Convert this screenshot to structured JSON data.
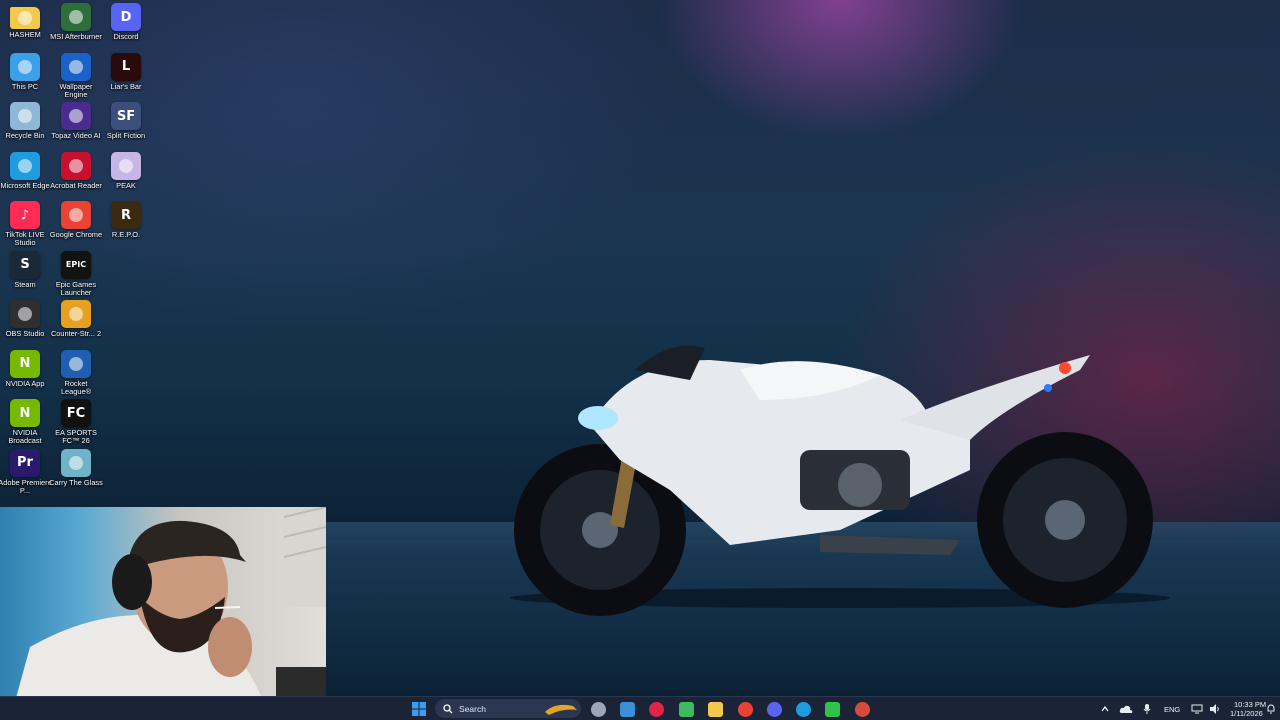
{
  "desktop": {
    "icons": [
      {
        "id": "hashem",
        "label": "HASHEM",
        "icon": "folder-icon",
        "color": "#f2c94c"
      },
      {
        "id": "this-pc",
        "label": "This PC",
        "icon": "monitor-icon",
        "color": "#3aa0e8"
      },
      {
        "id": "recycle-bin",
        "label": "Recycle Bin",
        "icon": "recycle-bin-icon",
        "color": "#8fb8d8"
      },
      {
        "id": "microsoft-edge",
        "label": "Microsoft Edge",
        "icon": "edge-icon",
        "color": "#1f9be0"
      },
      {
        "id": "tiktok-live-studio",
        "label": "TikTok LIVE Studio",
        "icon": "tiktok-icon",
        "color": "#fe2c55"
      },
      {
        "id": "steam",
        "label": "Steam",
        "icon": "steam-icon",
        "color": "#1b2838"
      },
      {
        "id": "obs-studio",
        "label": "OBS Studio",
        "icon": "obs-icon",
        "color": "#302e31"
      },
      {
        "id": "nvidia-app",
        "label": "NVIDIA App",
        "icon": "nvidia-icon",
        "color": "#76b900"
      },
      {
        "id": "nvidia-broadcast",
        "label": "NVIDIA Broadcast",
        "icon": "nvidia-broadcast-icon",
        "color": "#76b900"
      },
      {
        "id": "adobe-premiere",
        "label": "Adobe Premiere P...",
        "icon": "premiere-icon",
        "color": "#2a1a6e"
      },
      {
        "id": "msi-afterburner",
        "label": "MSI Afterburner",
        "icon": "afterburner-icon",
        "color": "#2d6e3a"
      },
      {
        "id": "wallpaper-engine",
        "label": "Wallpaper Engine",
        "icon": "wallpaper-engine-icon",
        "color": "#1a62c7"
      },
      {
        "id": "topaz-video-ai",
        "label": "Topaz Video AI",
        "icon": "topaz-icon",
        "color": "#4b2b8f"
      },
      {
        "id": "acrobat-reader",
        "label": "Acrobat Reader",
        "icon": "acrobat-icon",
        "color": "#c8102e"
      },
      {
        "id": "google-chrome",
        "label": "Google Chrome",
        "icon": "chrome-icon",
        "color": "#ea4335"
      },
      {
        "id": "epic-games",
        "label": "Epic Games Launcher",
        "icon": "epic-icon",
        "color": "#121212"
      },
      {
        "id": "counter-strike-2",
        "label": "Counter-Str... 2",
        "icon": "cs2-icon",
        "color": "#e8a020"
      },
      {
        "id": "rocket-league",
        "label": "Rocket League®",
        "icon": "rocket-league-icon",
        "color": "#1e5fb4"
      },
      {
        "id": "ea-fc-26",
        "label": "EA SPORTS FC™ 26",
        "icon": "ea-fc-icon",
        "color": "#111111"
      },
      {
        "id": "carry-the-glass",
        "label": "Carry The Glass",
        "icon": "carry-glass-icon",
        "color": "#6fb3c8"
      },
      {
        "id": "discord",
        "label": "Discord",
        "icon": "discord-icon",
        "color": "#5865f2"
      },
      {
        "id": "liars-bar",
        "label": "Liar's Bar",
        "icon": "liars-bar-icon",
        "color": "#2a0a0a"
      },
      {
        "id": "split-fiction",
        "label": "Split Fiction",
        "icon": "split-fiction-icon",
        "color": "#3b4f7a"
      },
      {
        "id": "peak",
        "label": "PEAK",
        "icon": "peak-icon",
        "color": "#c9b4e6"
      },
      {
        "id": "repo",
        "label": "R.E.P.O.",
        "icon": "repo-icon",
        "color": "#3a2a12"
      }
    ],
    "glyphs": {
      "tiktok": "♪",
      "steam": "S",
      "nvidia": "N",
      "premiere": "Pr",
      "epic": "EPIC",
      "ea": "FC",
      "discord": "D",
      "liars": "L",
      "split": "SF",
      "repo": "R"
    }
  },
  "taskbar": {
    "search_placeholder": "Search",
    "apps": [
      {
        "id": "start",
        "icon": "windows-start-icon",
        "color": "#3c9cf0"
      },
      {
        "id": "settings",
        "icon": "settings-gear-icon",
        "color": "#9aa7b8"
      },
      {
        "id": "photos",
        "icon": "photos-icon",
        "color": "#3a8fd8"
      },
      {
        "id": "opera",
        "icon": "opera-gx-icon",
        "color": "#e0244a"
      },
      {
        "id": "excel-like",
        "icon": "mixed-grid-icon",
        "color": "#3dbb5f"
      },
      {
        "id": "explorer",
        "icon": "file-explorer-icon",
        "color": "#f2c94c"
      },
      {
        "id": "chrome",
        "icon": "chrome-icon",
        "color": "#ea4335"
      },
      {
        "id": "discord",
        "icon": "discord-icon",
        "color": "#5865f2"
      },
      {
        "id": "edge",
        "icon": "edge-icon",
        "color": "#1f9be0"
      },
      {
        "id": "arrow-app",
        "icon": "green-arrow-icon",
        "color": "#32c24a"
      },
      {
        "id": "obs",
        "icon": "obs-icon",
        "color": "#d94a3a"
      }
    ],
    "tray": {
      "language": "ENG",
      "time": "10:33 PM",
      "date": "1/11/2026"
    }
  }
}
